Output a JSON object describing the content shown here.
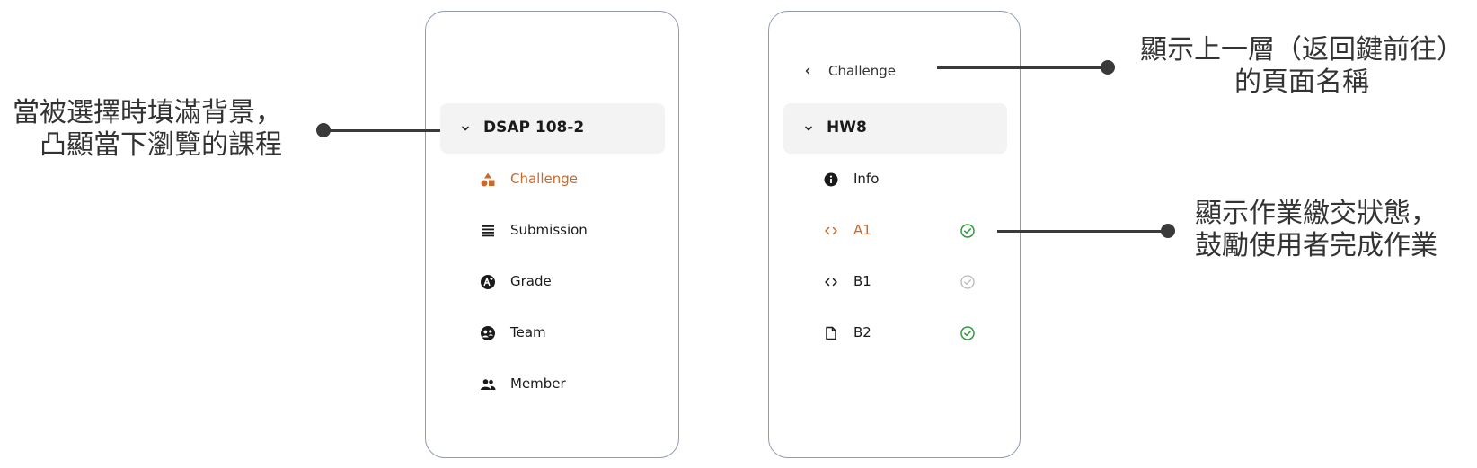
{
  "left_panel": {
    "course_title": "DSAP 108-2",
    "items": [
      {
        "label": "Challenge",
        "icon": "shapes-icon",
        "active": true
      },
      {
        "label": "Submission",
        "icon": "list-icon",
        "active": false
      },
      {
        "label": "Grade",
        "icon": "grade-icon",
        "active": false
      },
      {
        "label": "Team",
        "icon": "team-icon",
        "active": false
      },
      {
        "label": "Member",
        "icon": "people-icon",
        "active": false
      }
    ]
  },
  "right_panel": {
    "back_label": "Challenge",
    "homework_title": "HW8",
    "items": [
      {
        "label": "Info",
        "icon": "info-icon",
        "active": false,
        "status": null
      },
      {
        "label": "A1",
        "icon": "code-icon",
        "active": true,
        "status": "completed"
      },
      {
        "label": "B1",
        "icon": "code-icon",
        "active": false,
        "status": "pending"
      },
      {
        "label": "B2",
        "icon": "document-icon",
        "active": false,
        "status": "completed"
      }
    ]
  },
  "annotations": {
    "left": [
      "當被選擇時填滿背景，",
      "凸顯當下瀏覽的課程"
    ],
    "top_right": [
      "顯示上一層（返回鍵前往）",
      "的頁面名稱"
    ],
    "bottom_right": [
      "顯示作業繳交狀態，",
      "鼓勵使用者完成作業"
    ]
  },
  "colors": {
    "accent": "#c96a2a",
    "success": "#2e9b3f",
    "pending": "#b8b8b8",
    "selected_bg": "#f3f3f3",
    "panel_border": "#8f9bb3",
    "connector": "#3a3a3a"
  }
}
